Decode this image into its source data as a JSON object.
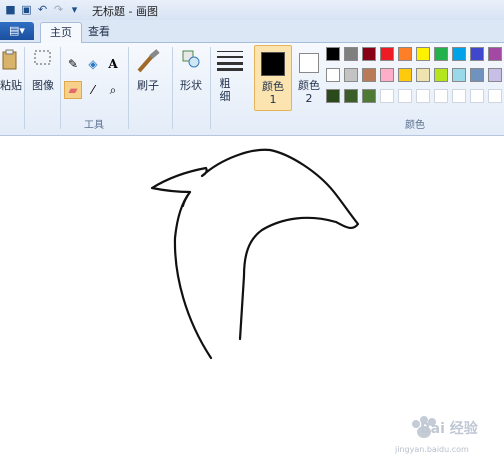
{
  "window": {
    "title": "无标题 - 画图"
  },
  "file_menu": {
    "label": ""
  },
  "tabs": [
    {
      "label": "主页"
    },
    {
      "label": "查看"
    }
  ],
  "ribbon": {
    "clipboard": {
      "label": "粘贴"
    },
    "image": {
      "label": "图像"
    },
    "tools": {
      "group_label": "工具"
    },
    "brushes": {
      "label": "刷子"
    },
    "shapes": {
      "label": "形状"
    },
    "size": {
      "label": "粗细"
    },
    "color1": {
      "label": "颜色 1",
      "color": "#000000"
    },
    "color2": {
      "label": "颜色 2",
      "color": "#ffffff"
    },
    "colors": {
      "group_label": "颜色",
      "row1": [
        "#000000",
        "#7f7f7f",
        "#880015",
        "#ed1c24",
        "#ff7f27",
        "#fff200",
        "#22b14c",
        "#00a2e8",
        "#3f48cc",
        "#a349a4"
      ],
      "row2": [
        "#ffffff",
        "#c3c3c3",
        "#b97a57",
        "#ffaec9",
        "#ffc90e",
        "#efe4b0",
        "#b5e61d",
        "#99d9ea",
        "#7092be",
        "#c8bfe7"
      ],
      "row3": [
        "#2b4a1c",
        "#3b5e29",
        "#4f7a35",
        "#ffffff",
        "#ffffff",
        "#ffffff",
        "#ffffff",
        "#ffffff",
        "#ffffff",
        "#ffffff"
      ]
    }
  },
  "watermark": {
    "text": "Bai 经验",
    "url": "jingyan.baidu.com"
  }
}
